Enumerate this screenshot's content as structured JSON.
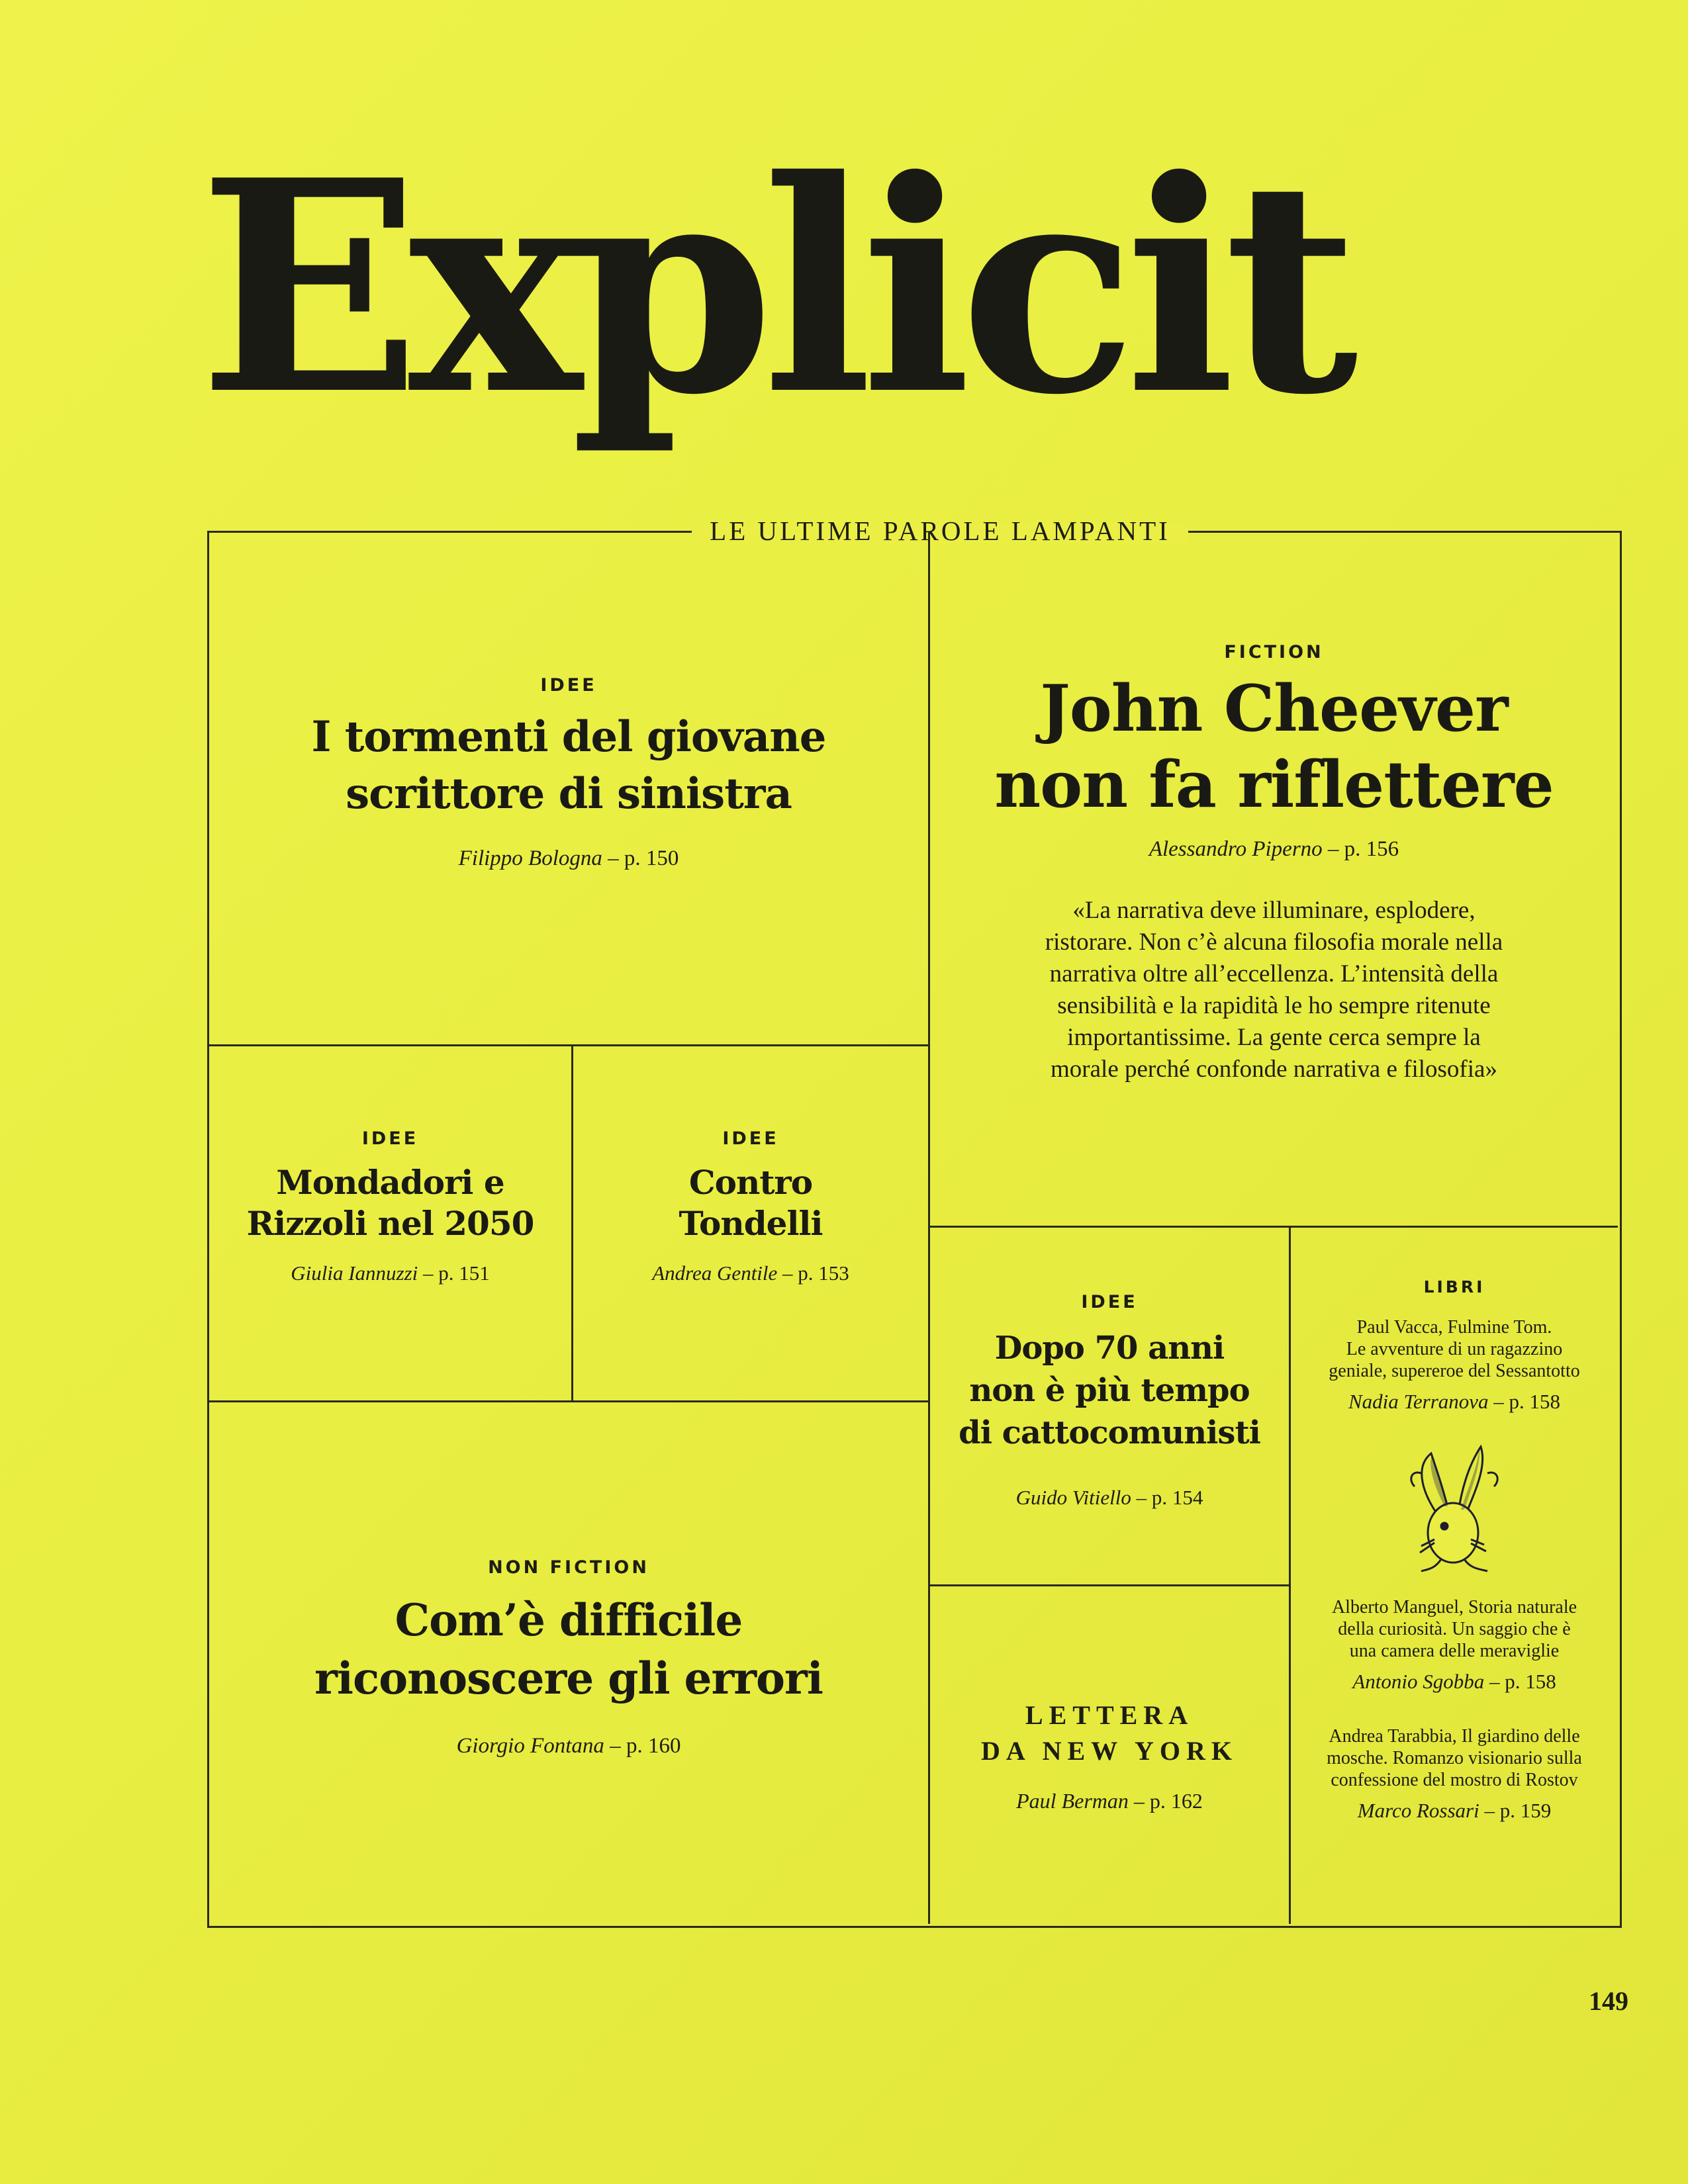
{
  "masthead": "Explicit",
  "tagline": "LE ULTIME PAROLE LAMPANTI",
  "articles": {
    "tormenti": {
      "kicker": "IDEE",
      "title_line1": "I tormenti del giovane",
      "title_line2": "scrittore di sinistra",
      "author": "Filippo Bologna",
      "page": "– p. 150"
    },
    "cheever": {
      "kicker": "FICTION",
      "title_line1": "John Cheever",
      "title_line2": "non fa riflettere",
      "author": "Alessandro Piperno",
      "page": "– p. 156",
      "quote": [
        "«La narrativa deve illuminare, esplodere,",
        "ristorare. Non c’è alcuna filosofia morale nella",
        "narrativa oltre all’eccellenza. L’intensità della",
        "sensibilità e la rapidità le ho sempre ritenute",
        "importantissime. La gente cerca sempre la",
        "morale perché confonde narrativa e filosofia»"
      ]
    },
    "mondadori": {
      "kicker": "IDEE",
      "title_line1": "Mondadori e",
      "title_line2": "Rizzoli nel 2050",
      "author": "Giulia Iannuzzi",
      "page": "– p. 151"
    },
    "tondelli": {
      "kicker": "IDEE",
      "title_line1": "Contro",
      "title_line2": "Tondelli",
      "author": "Andrea Gentile",
      "page": "– p. 153"
    },
    "cattocomunisti": {
      "kicker": "IDEE",
      "title_line1": "Dopo 70 anni",
      "title_line2": "non è più tempo",
      "title_line3": "di cattocomunisti",
      "author": "Guido Vitiello",
      "page": "– p. 154"
    },
    "errori": {
      "kicker": "NON FICTION",
      "title_line1": "Com’è difficile",
      "title_line2": "riconoscere gli errori",
      "author": "Giorgio Fontana",
      "page": "– p. 160"
    },
    "lettera": {
      "title_line1": "LETTERA",
      "title_line2": "DA NEW YORK",
      "author": "Paul Berman",
      "page": "– p. 162"
    },
    "libri": {
      "kicker": "LIBRI",
      "items": [
        {
          "lines": [
            "Paul Vacca, Fulmine Tom.",
            "Le avventure di un ragazzino",
            "geniale, supereroe del Sessantotto"
          ],
          "author": "Nadia Terranova",
          "page": "– p. 158"
        },
        {
          "lines": [
            "Alberto Manguel, Storia naturale",
            "della curiosità. Un saggio che è",
            "una camera delle meraviglie"
          ],
          "author": "Antonio Sgobba",
          "page": "– p. 158"
        },
        {
          "lines": [
            "Andrea Tarabbia, Il giardino delle",
            "mosche. Romanzo visionario sulla",
            "confessione del mostro di Rostov"
          ],
          "author": "Marco Rossari",
          "page": "– p. 159"
        }
      ]
    }
  },
  "page_number": "149",
  "colors": {
    "paper": "#eaee44",
    "ink": "#1a1a14"
  },
  "illustration_icon": "hare-head-icon"
}
